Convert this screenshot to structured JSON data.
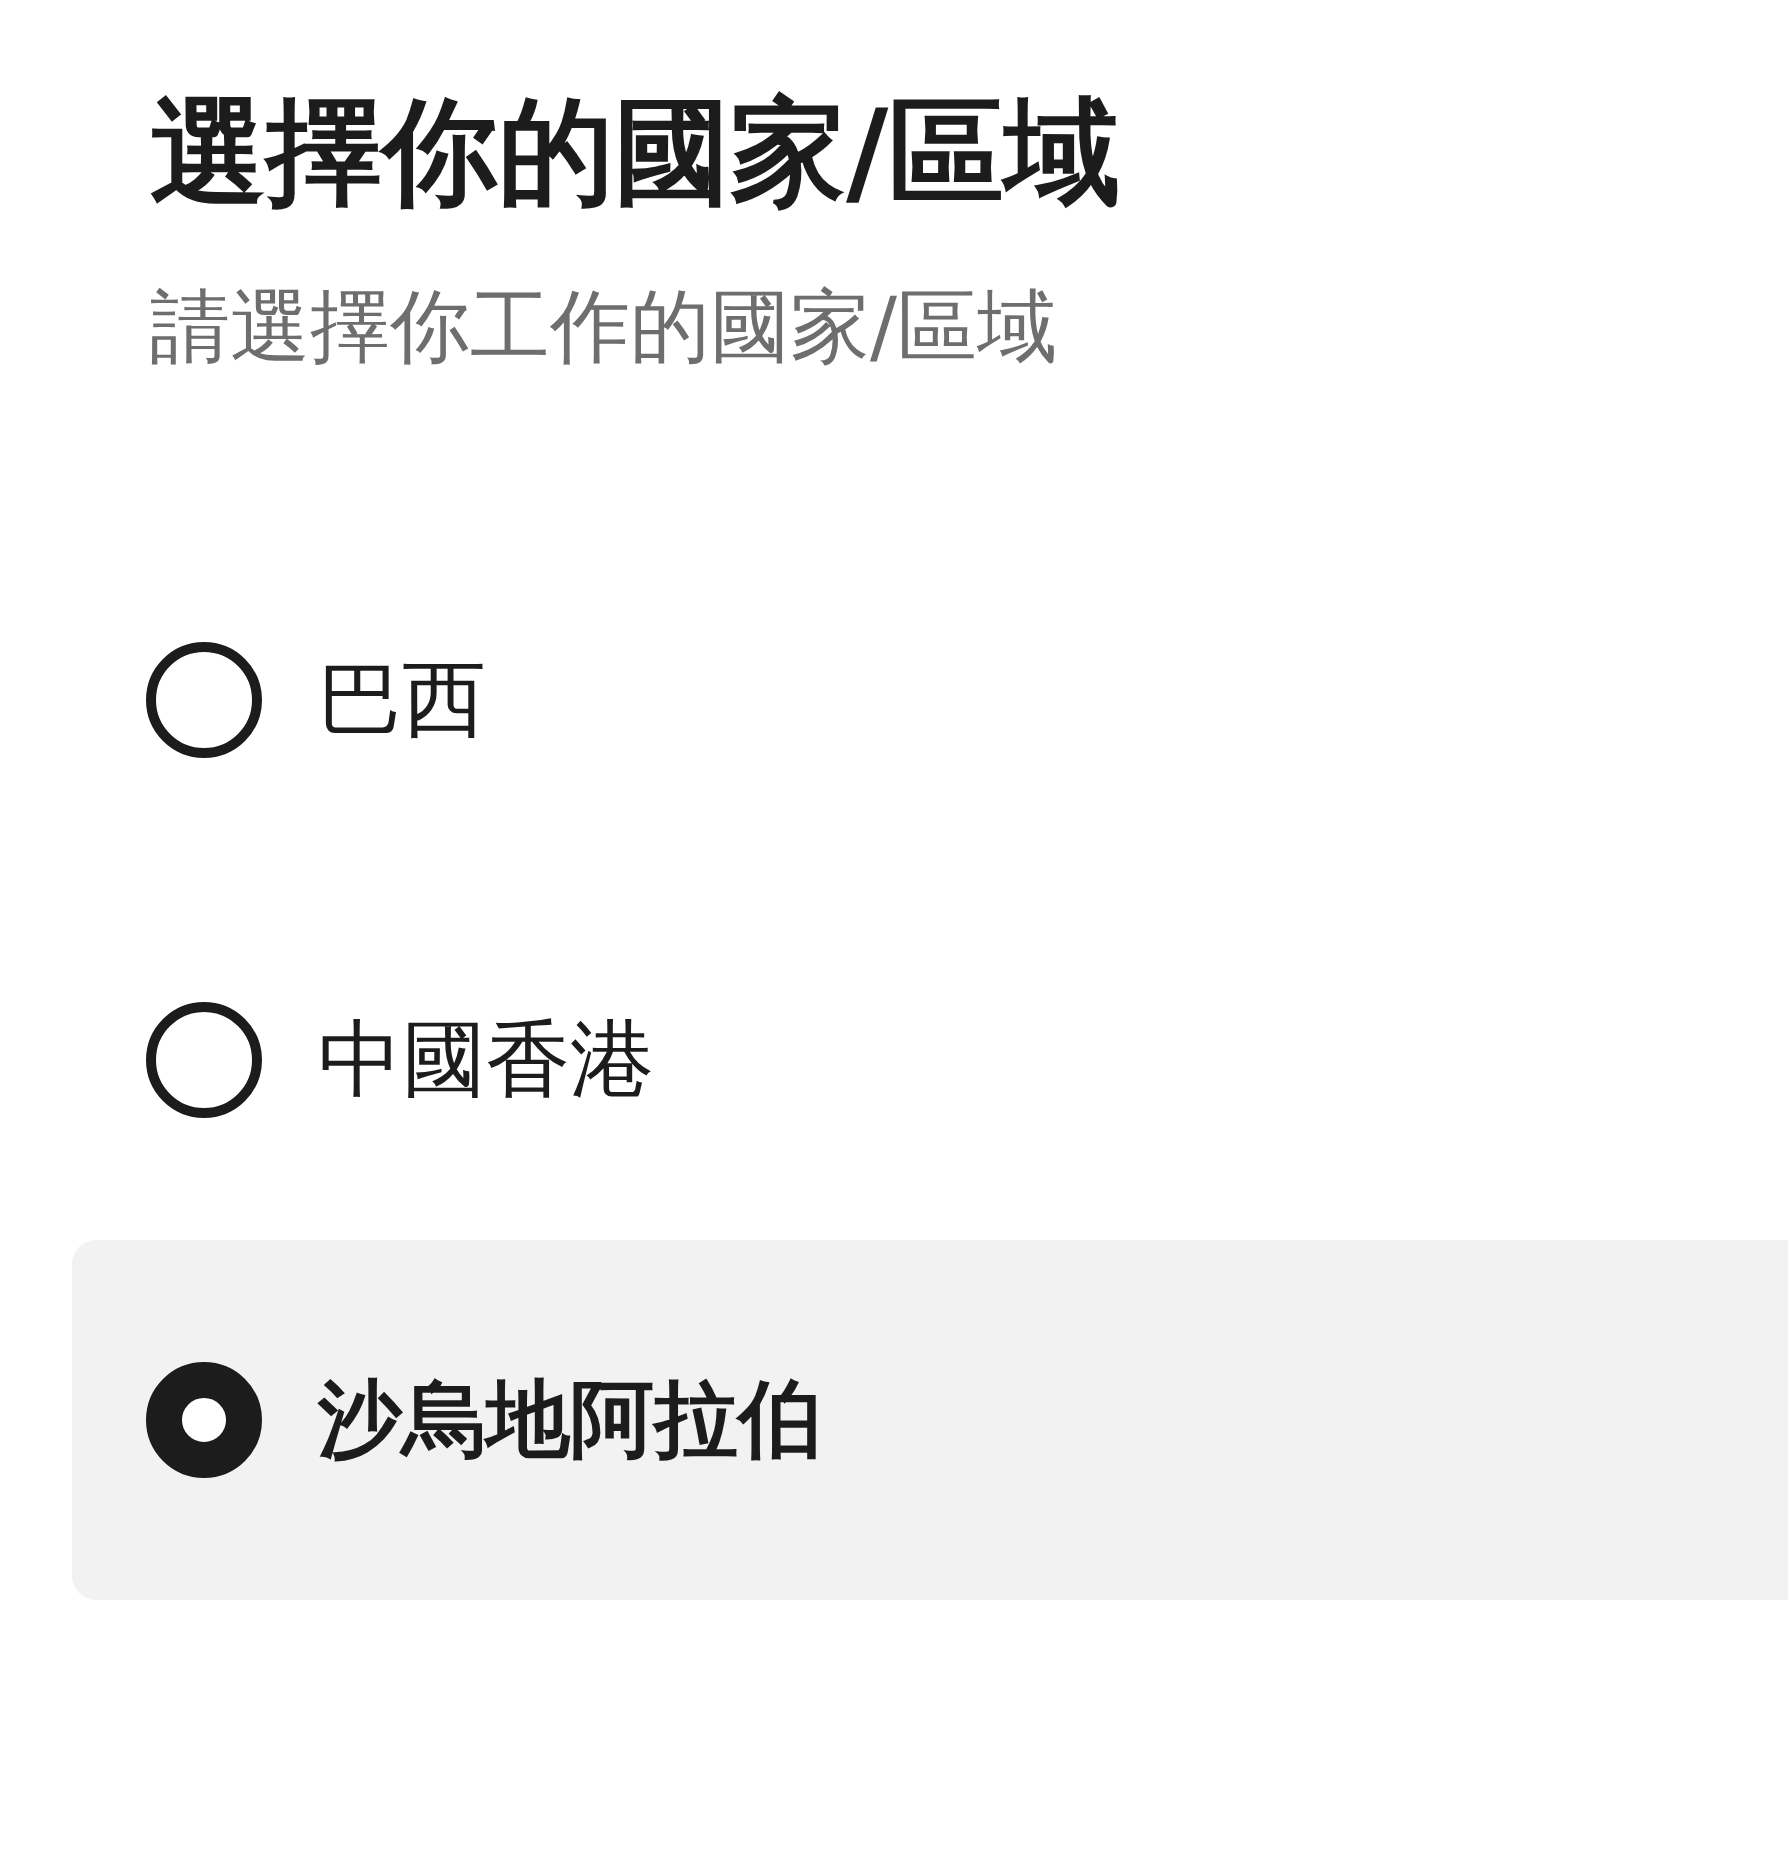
{
  "title": "選擇你的國家/區域",
  "subtitle": "請選擇你工作的國家/區域",
  "options": [
    {
      "label": "巴西",
      "selected": false
    },
    {
      "label": "中國香港",
      "selected": false
    },
    {
      "label": "沙烏地阿拉伯",
      "selected": true
    }
  ]
}
